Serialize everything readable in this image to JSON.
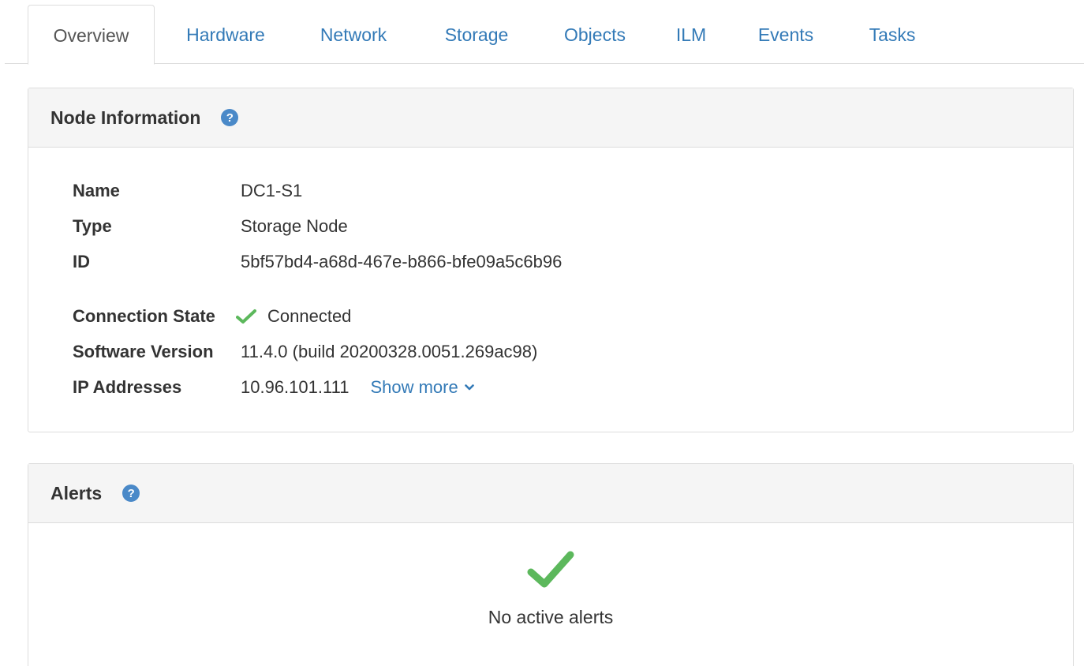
{
  "tabs": [
    {
      "label": "Overview",
      "active": true
    },
    {
      "label": "Hardware",
      "active": false
    },
    {
      "label": "Network",
      "active": false
    },
    {
      "label": "Storage",
      "active": false
    },
    {
      "label": "Objects",
      "active": false
    },
    {
      "label": "ILM",
      "active": false
    },
    {
      "label": "Events",
      "active": false
    },
    {
      "label": "Tasks",
      "active": false
    }
  ],
  "node_info": {
    "title": "Node Information",
    "help_glyph": "?",
    "rows": {
      "name": {
        "label": "Name",
        "value": "DC1-S1"
      },
      "type": {
        "label": "Type",
        "value": "Storage Node"
      },
      "id": {
        "label": "ID",
        "value": "5bf57bd4-a68d-467e-b866-bfe09a5c6b96"
      },
      "connection_state": {
        "label": "Connection State",
        "value": "Connected"
      },
      "software_version": {
        "label": "Software Version",
        "value": "11.4.0 (build 20200328.0051.269ac98)"
      },
      "ip_addresses": {
        "label": "IP Addresses",
        "value": "10.96.101.111",
        "show_more": "Show more"
      }
    }
  },
  "alerts": {
    "title": "Alerts",
    "help_glyph": "?",
    "empty_message": "No active alerts"
  },
  "icons": {
    "connected": "check-icon",
    "help": "question-circle-icon",
    "show_more": "chevron-down-icon",
    "no_alerts": "check-icon"
  },
  "colors": {
    "link": "#337ab7",
    "success": "#5cb85c",
    "help": "#4a89c8",
    "panel_heading": "#f5f5f5"
  }
}
